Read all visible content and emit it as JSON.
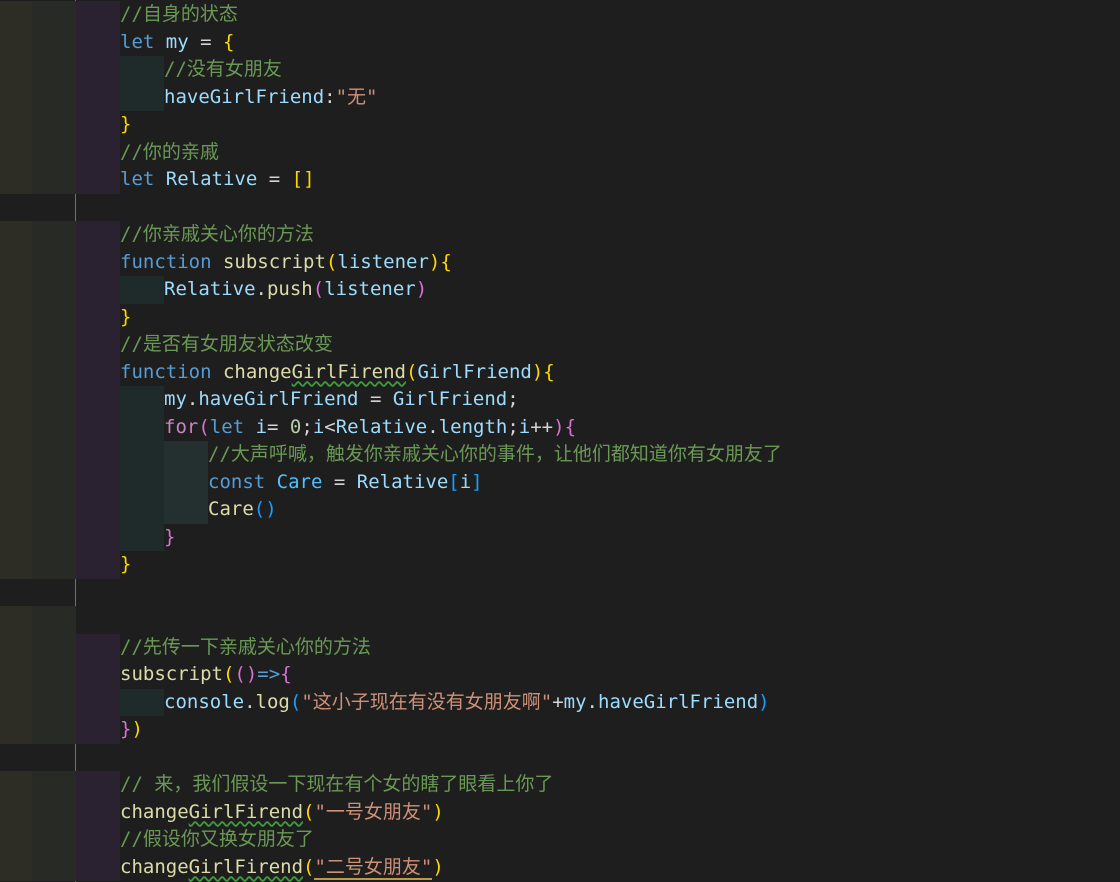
{
  "editor": {
    "language": "javascript",
    "theme": "dark",
    "lines": [
      {
        "indent": 3,
        "tokens": [
          {
            "c": "cmt",
            "t": "//自身的状态"
          }
        ]
      },
      {
        "indent": 3,
        "tokens": [
          {
            "c": "kw",
            "t": "let"
          },
          {
            "c": "op",
            "t": " "
          },
          {
            "c": "var",
            "t": "my"
          },
          {
            "c": "op",
            "t": " = "
          },
          {
            "c": "p1",
            "t": "{"
          }
        ]
      },
      {
        "indent": 4,
        "tokens": [
          {
            "c": "cmt",
            "t": "//没有女朋友"
          }
        ]
      },
      {
        "indent": 4,
        "tokens": [
          {
            "c": "var",
            "t": "haveGirlFriend"
          },
          {
            "c": "op",
            "t": ":"
          },
          {
            "c": "str",
            "t": "\"无\""
          }
        ]
      },
      {
        "indent": 3,
        "tokens": [
          {
            "c": "p1",
            "t": "}"
          }
        ]
      },
      {
        "indent": 3,
        "tokens": [
          {
            "c": "cmt",
            "t": "//你的亲戚"
          }
        ]
      },
      {
        "indent": 3,
        "tokens": [
          {
            "c": "kw",
            "t": "let"
          },
          {
            "c": "op",
            "t": " "
          },
          {
            "c": "var",
            "t": "Relative"
          },
          {
            "c": "op",
            "t": " = "
          },
          {
            "c": "p1",
            "t": "[]"
          }
        ]
      },
      {
        "indent": 0,
        "tokens": []
      },
      {
        "indent": 3,
        "tokens": [
          {
            "c": "cmt",
            "t": "//你亲戚关心你的方法"
          }
        ]
      },
      {
        "indent": 3,
        "tokens": [
          {
            "c": "kw",
            "t": "function"
          },
          {
            "c": "op",
            "t": " "
          },
          {
            "c": "fn",
            "t": "subscript"
          },
          {
            "c": "p1",
            "t": "("
          },
          {
            "c": "var",
            "t": "listener"
          },
          {
            "c": "p1",
            "t": ")"
          },
          {
            "c": "p1",
            "t": "{"
          }
        ]
      },
      {
        "indent": 4,
        "tokens": [
          {
            "c": "var",
            "t": "Relative"
          },
          {
            "c": "op",
            "t": "."
          },
          {
            "c": "fn",
            "t": "push"
          },
          {
            "c": "p2",
            "t": "("
          },
          {
            "c": "var",
            "t": "listener"
          },
          {
            "c": "p2",
            "t": ")"
          }
        ]
      },
      {
        "indent": 3,
        "tokens": [
          {
            "c": "p1",
            "t": "}"
          }
        ]
      },
      {
        "indent": 3,
        "tokens": [
          {
            "c": "cmt",
            "t": "//是否有女朋友状态改变"
          }
        ]
      },
      {
        "indent": 3,
        "tokens": [
          {
            "c": "kw",
            "t": "function"
          },
          {
            "c": "op",
            "t": " "
          },
          {
            "c": "fn",
            "t": "change"
          },
          {
            "c": "fn squiggle",
            "t": "GirlFirend"
          },
          {
            "c": "p1",
            "t": "("
          },
          {
            "c": "var",
            "t": "GirlFriend"
          },
          {
            "c": "p1",
            "t": ")"
          },
          {
            "c": "p1",
            "t": "{"
          }
        ]
      },
      {
        "indent": 4,
        "tokens": [
          {
            "c": "var",
            "t": "my"
          },
          {
            "c": "op",
            "t": "."
          },
          {
            "c": "var",
            "t": "haveGirlFriend"
          },
          {
            "c": "op",
            "t": " = "
          },
          {
            "c": "var",
            "t": "GirlFriend"
          },
          {
            "c": "op",
            "t": ";"
          }
        ]
      },
      {
        "indent": 4,
        "tokens": [
          {
            "c": "ctl",
            "t": "for"
          },
          {
            "c": "p2",
            "t": "("
          },
          {
            "c": "kw",
            "t": "let"
          },
          {
            "c": "op",
            "t": " "
          },
          {
            "c": "var",
            "t": "i"
          },
          {
            "c": "op",
            "t": "= "
          },
          {
            "c": "num",
            "t": "0"
          },
          {
            "c": "op",
            "t": ";"
          },
          {
            "c": "var",
            "t": "i"
          },
          {
            "c": "op",
            "t": "<"
          },
          {
            "c": "var",
            "t": "Relative"
          },
          {
            "c": "op",
            "t": "."
          },
          {
            "c": "var",
            "t": "length"
          },
          {
            "c": "op",
            "t": ";"
          },
          {
            "c": "var",
            "t": "i"
          },
          {
            "c": "op",
            "t": "++"
          },
          {
            "c": "p2",
            "t": ")"
          },
          {
            "c": "p2",
            "t": "{"
          }
        ]
      },
      {
        "indent": 5,
        "tokens": [
          {
            "c": "cmt",
            "t": "//大声呼喊，触发你亲戚关心你的事件，让他们都知道你有女朋友了"
          }
        ]
      },
      {
        "indent": 5,
        "tokens": [
          {
            "c": "kw",
            "t": "const"
          },
          {
            "c": "op",
            "t": " "
          },
          {
            "c": "cst",
            "t": "Care"
          },
          {
            "c": "op",
            "t": " = "
          },
          {
            "c": "var",
            "t": "Relative"
          },
          {
            "c": "p3",
            "t": "["
          },
          {
            "c": "var",
            "t": "i"
          },
          {
            "c": "p3",
            "t": "]"
          }
        ]
      },
      {
        "indent": 5,
        "tokens": [
          {
            "c": "fn",
            "t": "Care"
          },
          {
            "c": "p3",
            "t": "()"
          }
        ]
      },
      {
        "indent": 4,
        "tokens": [
          {
            "c": "p2",
            "t": "}"
          }
        ]
      },
      {
        "indent": 3,
        "tokens": [
          {
            "c": "p1",
            "t": "}"
          }
        ]
      },
      {
        "indent": 0,
        "tokens": []
      },
      {
        "indent": 2,
        "tokens": []
      },
      {
        "indent": 3,
        "tokens": [
          {
            "c": "cmt",
            "t": "//先传一下亲戚关心你的方法"
          }
        ]
      },
      {
        "indent": 3,
        "tokens": [
          {
            "c": "fn",
            "t": "subscript"
          },
          {
            "c": "p1",
            "t": "("
          },
          {
            "c": "p2",
            "t": "()"
          },
          {
            "c": "kw",
            "t": "=>"
          },
          {
            "c": "p2",
            "t": "{"
          }
        ]
      },
      {
        "indent": 4,
        "tokens": [
          {
            "c": "var",
            "t": "console"
          },
          {
            "c": "op",
            "t": "."
          },
          {
            "c": "fn",
            "t": "log"
          },
          {
            "c": "p3",
            "t": "("
          },
          {
            "c": "str",
            "t": "\"这小子现在有没有女朋友啊\""
          },
          {
            "c": "op",
            "t": "+"
          },
          {
            "c": "var",
            "t": "my"
          },
          {
            "c": "op",
            "t": "."
          },
          {
            "c": "var",
            "t": "haveGirlFriend"
          },
          {
            "c": "p3",
            "t": ")"
          }
        ]
      },
      {
        "indent": 3,
        "tokens": [
          {
            "c": "p2",
            "t": "}"
          },
          {
            "c": "p1",
            "t": ")"
          }
        ]
      },
      {
        "indent": 0,
        "tokens": []
      },
      {
        "indent": 3,
        "tokens": [
          {
            "c": "cmt",
            "t": "// 来，我们假设一下现在有个女的瞎了眼看上你了"
          }
        ]
      },
      {
        "indent": 3,
        "tokens": [
          {
            "c": "fn",
            "t": "change"
          },
          {
            "c": "fn squiggle",
            "t": "GirlFirend"
          },
          {
            "c": "p1",
            "t": "("
          },
          {
            "c": "str",
            "t": "\"一号女朋友\""
          },
          {
            "c": "p1",
            "t": ")"
          }
        ]
      },
      {
        "indent": 3,
        "tokens": [
          {
            "c": "cmt",
            "t": "//假设你又换女朋友了"
          }
        ]
      },
      {
        "indent": 3,
        "tokens": [
          {
            "c": "fn",
            "t": "change"
          },
          {
            "c": "fn squiggle",
            "t": "GirlFirend"
          },
          {
            "c": "p1",
            "t": "("
          },
          {
            "c": "str strhl",
            "t": "\"二号女朋友\""
          },
          {
            "c": "p1",
            "t": ")"
          }
        ]
      }
    ],
    "indent_colors": [
      "#2d2d25",
      "#272a25",
      "#2a2230",
      "#1f2a2a",
      "#23302f",
      "#2f2e22"
    ]
  }
}
